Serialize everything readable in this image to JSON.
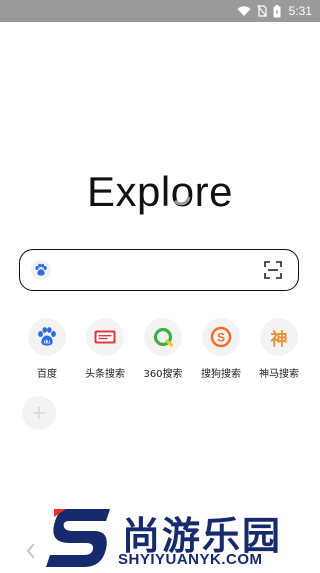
{
  "status_bar": {
    "time": "5:31",
    "icons": [
      "wifi-icon",
      "no-sim-icon",
      "battery-icon"
    ]
  },
  "logo": {
    "text": "Explore"
  },
  "search": {
    "engine_icon": "baidu-paw-icon",
    "scan_icon": "scan-icon",
    "value": ""
  },
  "shortcuts": [
    {
      "label": "百度",
      "icon": "baidu-icon",
      "color": "#2b6de5"
    },
    {
      "label": "头条搜索",
      "icon": "toutiao-icon",
      "color": "#e4393c"
    },
    {
      "label": "360搜索",
      "icon": "so360-icon",
      "color": "#3db13d"
    },
    {
      "label": "搜狗搜索",
      "icon": "sogou-icon",
      "color": "#fa6a1e"
    },
    {
      "label": "神马搜索",
      "icon": "shenma-icon",
      "glyph": "神",
      "color": "#e8913a"
    }
  ],
  "add_button": {
    "icon": "plus-icon"
  },
  "nav": {
    "back_icon": "chevron-left-icon"
  },
  "watermark": {
    "cn_text": "尚游乐园",
    "url_text": "SHYIYUANYK.COM",
    "color": "#162a6e",
    "accent": "#e8322a"
  }
}
